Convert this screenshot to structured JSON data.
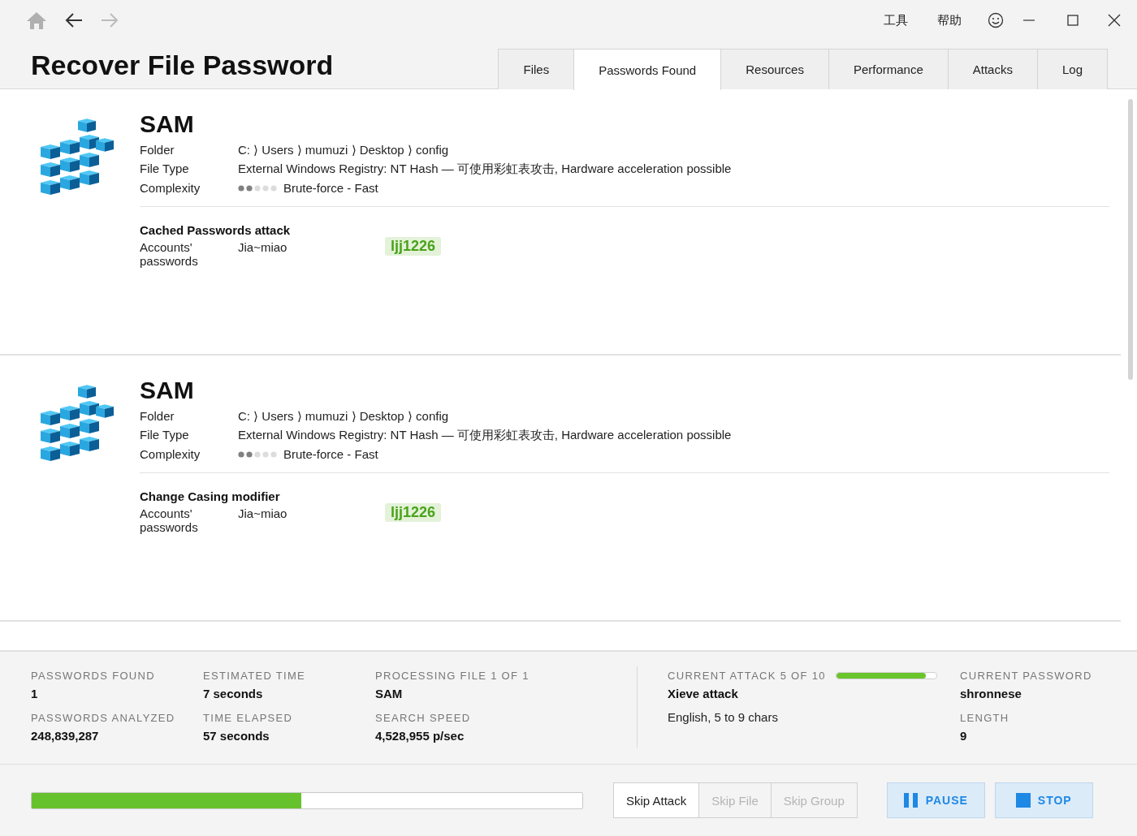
{
  "nav": {
    "back_disabled": false,
    "forward_disabled": true
  },
  "menu": [
    "工具",
    "帮助"
  ],
  "title": "Recover File Password",
  "tabs": [
    {
      "label": "Files",
      "selected": false
    },
    {
      "label": "Passwords Found",
      "selected": true
    },
    {
      "label": "Resources",
      "selected": false
    },
    {
      "label": "Performance",
      "selected": false
    },
    {
      "label": "Attacks",
      "selected": false
    },
    {
      "label": "Log",
      "selected": false
    }
  ],
  "results": [
    {
      "name": "SAM",
      "fields": [
        {
          "label": "Folder",
          "value": "C: ⟩ Users ⟩ mumuzi ⟩ Desktop ⟩ config"
        },
        {
          "label": "File Type",
          "value": "External Windows Registry: NT Hash — 可使用彩虹表攻击, Hardware acceleration possible"
        }
      ],
      "complexity": {
        "label": "Complexity",
        "level": 0.4,
        "text": "Brute-force - Fast"
      },
      "attack": "Cached Passwords attack",
      "accounts_label": "Accounts' passwords",
      "account": "Jia~miao",
      "password": "ljj1226"
    },
    {
      "name": "SAM",
      "fields": [
        {
          "label": "Folder",
          "value": "C: ⟩ Users ⟩ mumuzi ⟩ Desktop ⟩ config"
        },
        {
          "label": "File Type",
          "value": "External Windows Registry: NT Hash — 可使用彩虹表攻击, Hardware acceleration possible"
        }
      ],
      "complexity": {
        "label": "Complexity",
        "level": 0.4,
        "text": "Brute-force - Fast"
      },
      "attack": "Change Casing modifier",
      "accounts_label": "Accounts' passwords",
      "account": "Jia~miao",
      "password": "ljj1226"
    }
  ],
  "stats": {
    "columns": [
      [
        {
          "label": "PASSWORDS FOUND",
          "value": "1"
        },
        {
          "label": "PASSWORDS ANALYZED",
          "value": "248,839,287"
        }
      ],
      [
        {
          "label": "ESTIMATED TIME",
          "value": "7 seconds"
        },
        {
          "label": "TIME ELAPSED",
          "value": "57 seconds"
        }
      ],
      [
        {
          "label": "PROCESSING FILE 1 OF 1",
          "value": "SAM"
        },
        {
          "label": "SEARCH SPEED",
          "value": "4,528,955 p/sec"
        }
      ]
    ],
    "current_attack": {
      "label": "CURRENT ATTACK 5 OF 10",
      "level": 0.9,
      "name": "Xieve attack",
      "detail": "English, 5 to 9 chars"
    },
    "current": [
      {
        "label": "CURRENT PASSWORD",
        "value": "shronnese"
      },
      {
        "label": "LENGTH",
        "value": "9"
      }
    ]
  },
  "progress": {
    "level": 0.49
  },
  "skip_buttons": [
    {
      "label": "Skip Attack",
      "disabled": false
    },
    {
      "label": "Skip File",
      "disabled": true
    },
    {
      "label": "Skip Group",
      "disabled": true
    }
  ],
  "actions": [
    {
      "kind": "pause",
      "label": "PAUSE"
    },
    {
      "kind": "stop",
      "label": "STOP"
    }
  ]
}
